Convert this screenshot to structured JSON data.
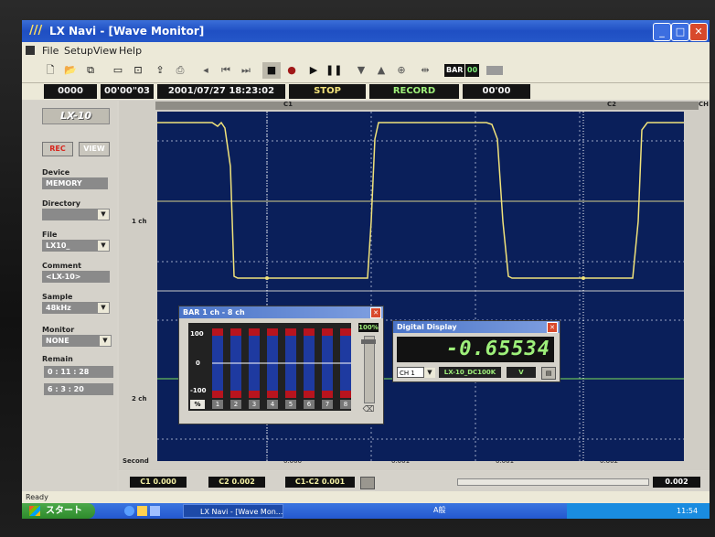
{
  "window": {
    "title": "LX Navi - [Wave Monitor]",
    "app_icon": "lx-navi-icon"
  },
  "menu": [
    "File",
    "Setup",
    "View",
    "Help"
  ],
  "toolbar": {
    "bar_label": "BAR",
    "counter_label": "00"
  },
  "status_strip": {
    "counter": "0000",
    "elapsed": "00'00\"03",
    "datetime": "2001/07/27 18:23:02",
    "state": "STOP",
    "mode": "RECORD",
    "record_time": "00'00"
  },
  "left_panel": {
    "logo": "LX-10",
    "rec_button": "REC",
    "view_button": "VIEW",
    "device_label": "Device",
    "device_value": "MEMORY",
    "directory_label": "Directory",
    "directory_value": "",
    "file_label": "File",
    "file_value": "LX10_",
    "comment_label": "Comment",
    "comment_value": "<LX-10>",
    "sample_label": "Sample",
    "sample_value": "48kHz",
    "monitor_label": "Monitor",
    "monitor_value": "NONE",
    "remain_label": "Remain",
    "remain_1": "0 : 11 : 28",
    "remain_2": "6 : 3 : 20"
  },
  "wave": {
    "cursor_c1": "C1",
    "cursor_c2": "C2",
    "ch_label": "CH",
    "ch1_label": "1 ch",
    "ch2_label": "2 ch",
    "x_axis_label": "Second",
    "x_ticks": [
      "0.000",
      "0.001",
      "0.001",
      "0.002"
    ]
  },
  "cursor_bar": {
    "c1": "C1 0.000",
    "c2": "C2 0.002",
    "diff": "C1-C2 0.001",
    "right_value": "0.002"
  },
  "bar_window": {
    "title": "BAR 1 ch - 8 ch",
    "percent": "100%",
    "scale": [
      "100",
      "0",
      "-100"
    ],
    "pct_button": "%",
    "channels": [
      "1",
      "2",
      "3",
      "4",
      "5",
      "6",
      "7",
      "8"
    ]
  },
  "digital_display": {
    "title": "Digital Display",
    "value": "-0.65534",
    "channel": "CH 1",
    "device": "LX-10_DC100K",
    "unit": "V"
  },
  "statusbar": {
    "text": "Ready"
  },
  "taskbar": {
    "start": "スタート",
    "task": "LX Navi - [Wave Mon...",
    "ime": "A般",
    "clock": "11:54"
  },
  "colors": {
    "plot_bg": "#0a1f5a",
    "trace": "#f0e27a",
    "ch2_line": "#7ee05a",
    "digits": "#9ef07a"
  }
}
